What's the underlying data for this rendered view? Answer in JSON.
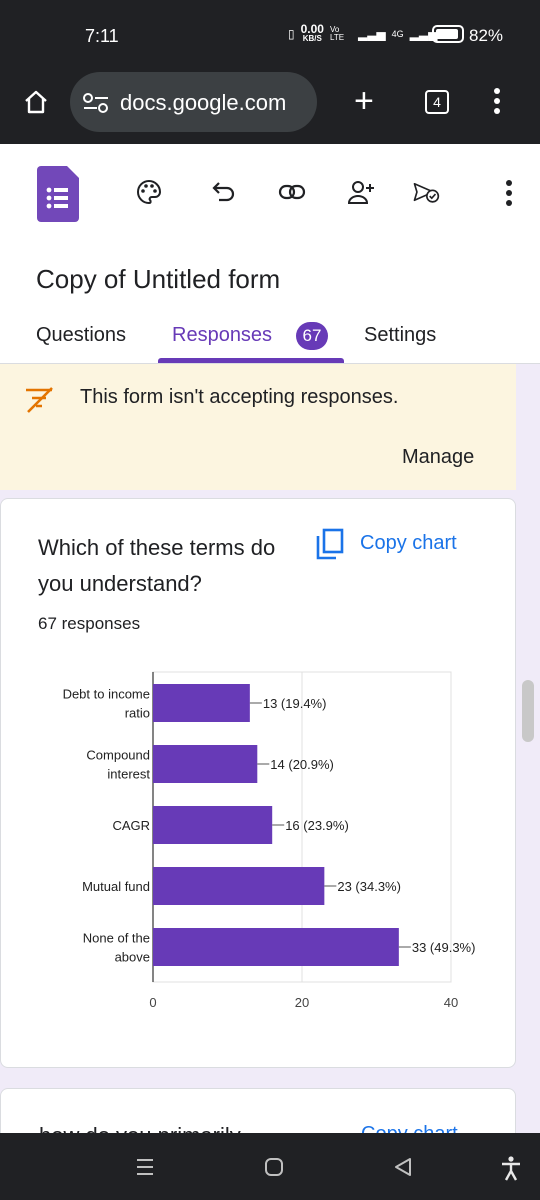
{
  "status_bar": {
    "time": "7:11",
    "net_speed": "0.00",
    "net_unit": "KB/S",
    "volte": "Vo LTE",
    "network": "4G",
    "battery": "82%"
  },
  "browser": {
    "url": "docs.google.com",
    "tab_count": "4"
  },
  "form": {
    "title": "Copy of Untitled form",
    "tabs": {
      "questions": "Questions",
      "responses": "Responses",
      "responses_count": "67",
      "settings": "Settings"
    }
  },
  "banner": {
    "message": "This form isn't accepting responses.",
    "manage": "Manage"
  },
  "question": {
    "title": "Which of these terms do you understand?",
    "responses": "67 responses",
    "copy_chart": "Copy chart"
  },
  "next_question": {
    "title": "how do you primarily...",
    "copy_chart": "Copy chart"
  },
  "colors": {
    "accent": "#673ab7",
    "bar": "#673ab7",
    "link": "#1a73e8",
    "banner": "#fcf5e0",
    "page_bg": "#f0ebf8"
  },
  "chart_data": {
    "type": "bar",
    "orientation": "horizontal",
    "categories": [
      [
        "Debt to income",
        "ratio"
      ],
      [
        "Compound",
        "interest"
      ],
      [
        "CAGR"
      ],
      [
        "Mutual fund"
      ],
      [
        "None of the",
        "above"
      ]
    ],
    "values": [
      13,
      14,
      16,
      23,
      33
    ],
    "labels": [
      "13 (19.4%)",
      "14 (20.9%)",
      "16 (23.9%)",
      "23 (34.3%)",
      "33 (49.3%)"
    ],
    "xticks": [
      "0",
      "20",
      "40"
    ],
    "xlim": [
      0,
      40
    ],
    "grid": true
  }
}
